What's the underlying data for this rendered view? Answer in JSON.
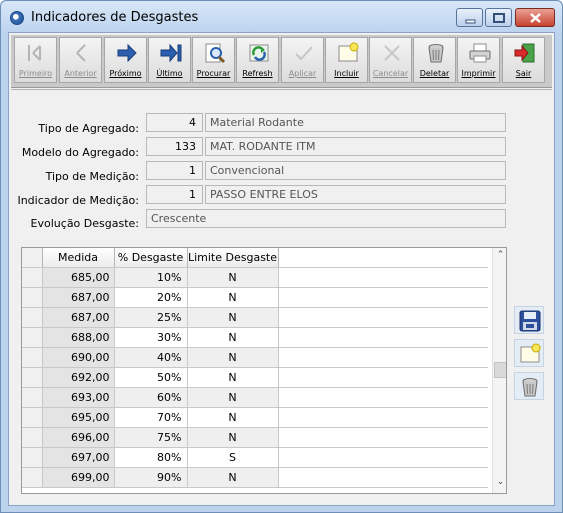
{
  "window": {
    "title": "Indicadores de Desgastes"
  },
  "toolbar": {
    "buttons": [
      {
        "label": "Primeiro",
        "enabled": false,
        "icon": "first-icon"
      },
      {
        "label": "Anterior",
        "enabled": false,
        "icon": "previous-icon"
      },
      {
        "label": "Próximo",
        "enabled": true,
        "icon": "next-icon"
      },
      {
        "label": "Último",
        "enabled": true,
        "icon": "last-icon"
      },
      {
        "label": "Procurar",
        "enabled": true,
        "icon": "search-icon"
      },
      {
        "label": "Refresh",
        "enabled": true,
        "icon": "refresh-icon"
      },
      {
        "label": "Aplicar",
        "enabled": false,
        "icon": "apply-icon"
      },
      {
        "label": "Incluir",
        "enabled": true,
        "icon": "new-icon"
      },
      {
        "label": "Cancelar",
        "enabled": false,
        "icon": "cancel-icon"
      },
      {
        "label": "Deletar",
        "enabled": true,
        "icon": "trash-icon"
      },
      {
        "label": "Imprimir",
        "enabled": true,
        "icon": "printer-icon"
      },
      {
        "label": "Sair",
        "enabled": true,
        "icon": "exit-icon"
      }
    ]
  },
  "form": {
    "tipo_agregado": {
      "label": "Tipo de Agregado:",
      "code": "4",
      "desc": "Material Rodante"
    },
    "modelo_agregado": {
      "label": "Modelo do Agregado:",
      "code": "133",
      "desc": "MAT. RODANTE ITM"
    },
    "tipo_medicao": {
      "label": "Tipo de Medição:",
      "code": "1",
      "desc": "Convencional"
    },
    "indicador_medicao": {
      "label": "Indicador de Medição:",
      "code": "1",
      "desc": "PASSO ENTRE ELOS"
    },
    "evolucao": {
      "label": "Evolução Desgaste:",
      "value": "Crescente"
    }
  },
  "grid": {
    "columns": [
      "Medida",
      "% Desgaste",
      "Limite Desgaste"
    ],
    "rows": [
      [
        "685,00",
        "10%",
        "N"
      ],
      [
        "687,00",
        "20%",
        "N"
      ],
      [
        "687,00",
        "25%",
        "N"
      ],
      [
        "688,00",
        "30%",
        "N"
      ],
      [
        "690,00",
        "40%",
        "N"
      ],
      [
        "692,00",
        "50%",
        "N"
      ],
      [
        "693,00",
        "60%",
        "N"
      ],
      [
        "695,00",
        "70%",
        "N"
      ],
      [
        "696,00",
        "75%",
        "N"
      ],
      [
        "697,00",
        "80%",
        "S"
      ],
      [
        "699,00",
        "90%",
        "N"
      ]
    ]
  },
  "side_buttons": [
    "save-icon",
    "new-record-icon",
    "delete-icon"
  ]
}
